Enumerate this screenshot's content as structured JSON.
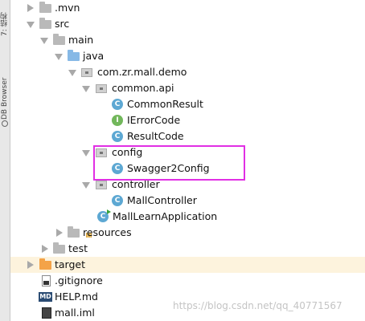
{
  "sidebar": {
    "tab_structure": "7: 结构",
    "tab_db_browser": "DB Browser"
  },
  "tree": {
    "items": [
      {
        "label": ".mvn",
        "expanded": false,
        "icon": "folder-icon"
      },
      {
        "label": "src",
        "expanded": true,
        "icon": "folder-icon"
      },
      {
        "label": "main",
        "expanded": true,
        "icon": "folder-icon"
      },
      {
        "label": "java",
        "expanded": true,
        "icon": "source-folder-icon"
      },
      {
        "label": "com.zr.mall.demo",
        "expanded": true,
        "icon": "package-icon"
      },
      {
        "label": "common.api",
        "expanded": true,
        "icon": "package-icon"
      },
      {
        "label": "CommonResult",
        "icon": "class-icon",
        "glyph": "C"
      },
      {
        "label": "IErrorCode",
        "icon": "interface-icon",
        "glyph": "I"
      },
      {
        "label": "ResultCode",
        "icon": "class-icon",
        "glyph": "C"
      },
      {
        "label": "config",
        "expanded": true,
        "icon": "package-icon"
      },
      {
        "label": "Swagger2Config",
        "icon": "class-icon",
        "glyph": "C"
      },
      {
        "label": "controller",
        "expanded": true,
        "icon": "package-icon"
      },
      {
        "label": "MallController",
        "icon": "class-icon",
        "glyph": "C"
      },
      {
        "label": "MallLearnApplication",
        "icon": "spring-boot-class-icon",
        "glyph": "C"
      },
      {
        "label": "resources",
        "expanded": false,
        "icon": "resources-folder-icon"
      },
      {
        "label": "test",
        "expanded": false,
        "icon": "folder-icon"
      },
      {
        "label": "target",
        "expanded": false,
        "icon": "excluded-folder-icon",
        "selected": true
      },
      {
        "label": ".gitignore",
        "icon": "gitignore-file-icon"
      },
      {
        "label": "HELP.md",
        "icon": "markdown-file-icon",
        "glyph": "MD"
      },
      {
        "label": "mall.iml",
        "icon": "iml-file-icon"
      }
    ]
  },
  "highlight_color": "#e12fe4",
  "selection_color": "#fdf3dd",
  "watermark": "https://blog.csdn.net/qq_40771567"
}
